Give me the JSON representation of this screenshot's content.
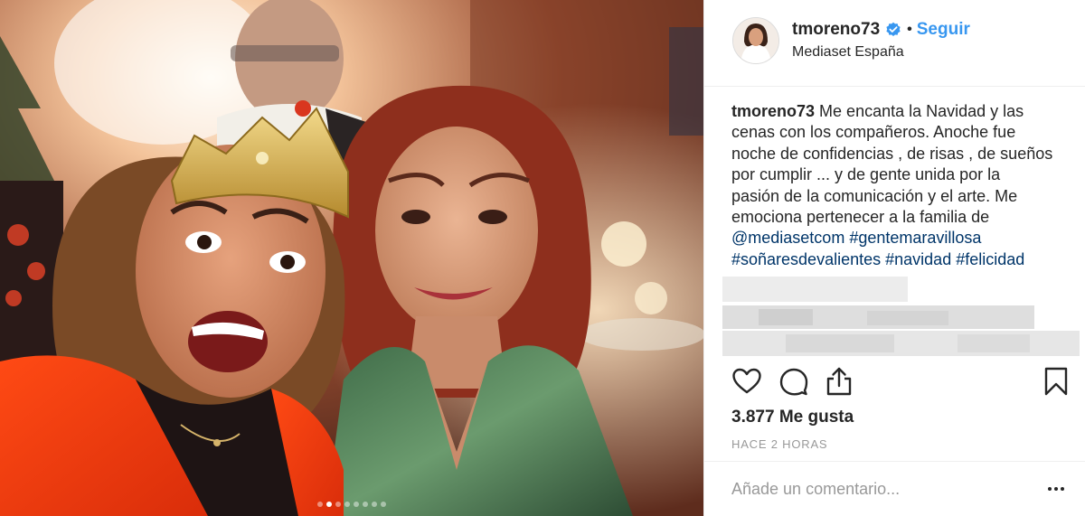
{
  "post": {
    "username": "tmoreno73",
    "verified": true,
    "separator": "•",
    "follow_label": "Seguir",
    "location": "Mediaset España",
    "caption": {
      "username": "tmoreno73",
      "lines": [
        "Me encanta la Navidad y las",
        "cenas con los compañeros. Anoche fue",
        "noche de confidencias , de risas , de sueños",
        "por cumplir ... y de gente unida por la",
        "pasión de la comunicación y el arte. Me",
        "emociona pertenecer a la familia de"
      ],
      "tags_line1": [
        "@mediasetcom",
        "#gentemaravillosa"
      ],
      "tags_line2": [
        "#soñaresdevalientes",
        "#navidad",
        "#felicidad"
      ]
    },
    "likes_text": "3.877 Me gusta",
    "timestamp": "HACE 2 HORAS",
    "comment_placeholder": "Añade un comentario...",
    "carousel": {
      "count": 8,
      "active_index": 1
    }
  },
  "icons": {
    "verified": "verified-badge-icon",
    "like": "heart-icon",
    "comment": "comment-bubble-icon",
    "share": "share-icon",
    "save": "bookmark-icon",
    "more": "more-dots-icon"
  },
  "colors": {
    "link": "#3897f0",
    "hashtag": "#003569",
    "text": "#262626",
    "muted": "#999999",
    "divider": "#efefef"
  }
}
